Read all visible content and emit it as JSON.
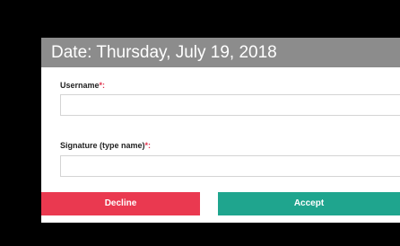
{
  "header": {
    "date_text": "Date: Thursday, July 19, 2018"
  },
  "form": {
    "username": {
      "label": "Username",
      "required_mark": "*:",
      "value": "",
      "placeholder": ""
    },
    "signature": {
      "label": "Signature (type name)",
      "required_mark": "*:",
      "value": "",
      "placeholder": ""
    }
  },
  "actions": {
    "decline_label": "Decline",
    "accept_label": "Accept"
  },
  "colors": {
    "header_bg": "#8c8c8c",
    "decline": "#ea3950",
    "accept": "#1fa58e",
    "required": "#e0334d"
  }
}
